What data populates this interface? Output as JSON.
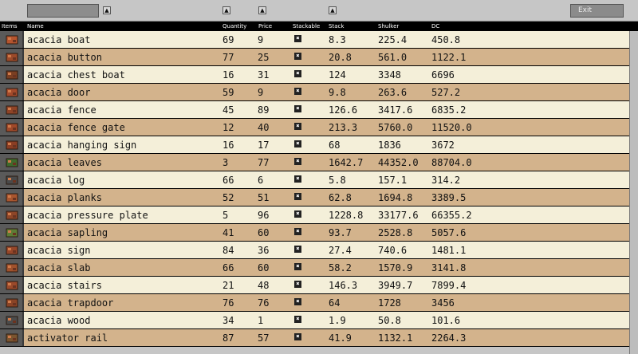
{
  "toolbar": {
    "search_value": "",
    "sort_glyph": "▲",
    "exit_label": "Exit"
  },
  "columns": {
    "items": "Items",
    "name": "Name",
    "quantity": "Quantity",
    "price": "Price",
    "stackable": "Stackable",
    "stack": "Stack",
    "shulker": "Shulker",
    "dc": "DC"
  },
  "rows": [
    {
      "name": "acacia boat",
      "quantity": "69",
      "price": "9",
      "stackable_glyph": "✖",
      "stack": "8.3",
      "shulker": "225.4",
      "dc": "450.8",
      "icon": "boat-icon"
    },
    {
      "name": "acacia button",
      "quantity": "77",
      "price": "25",
      "stackable_glyph": "✖",
      "stack": "20.8",
      "shulker": "561.0",
      "dc": "1122.1",
      "icon": "button-icon"
    },
    {
      "name": "acacia chest boat",
      "quantity": "16",
      "price": "31",
      "stackable_glyph": "✖",
      "stack": "124",
      "shulker": "3348",
      "dc": "6696",
      "icon": "chest-boat-icon"
    },
    {
      "name": "acacia door",
      "quantity": "59",
      "price": "9",
      "stackable_glyph": "✖",
      "stack": "9.8",
      "shulker": "263.6",
      "dc": "527.2",
      "icon": "door-icon"
    },
    {
      "name": "acacia fence",
      "quantity": "45",
      "price": "89",
      "stackable_glyph": "✖",
      "stack": "126.6",
      "shulker": "3417.6",
      "dc": "6835.2",
      "icon": "fence-icon"
    },
    {
      "name": "acacia fence gate",
      "quantity": "12",
      "price": "40",
      "stackable_glyph": "✖",
      "stack": "213.3",
      "shulker": "5760.0",
      "dc": "11520.0",
      "icon": "fence-gate-icon"
    },
    {
      "name": "acacia hanging sign",
      "quantity": "16",
      "price": "17",
      "stackable_glyph": "✖",
      "stack": "68",
      "shulker": "1836",
      "dc": "3672",
      "icon": "hanging-sign-icon"
    },
    {
      "name": "acacia leaves",
      "quantity": "3",
      "price": "77",
      "stackable_glyph": "✖",
      "stack": "1642.7",
      "shulker": "44352.0",
      "dc": "88704.0",
      "icon": "leaves-icon"
    },
    {
      "name": "acacia log",
      "quantity": "66",
      "price": "6",
      "stackable_glyph": "✖",
      "stack": "5.8",
      "shulker": "157.1",
      "dc": "314.2",
      "icon": "log-icon"
    },
    {
      "name": "acacia planks",
      "quantity": "52",
      "price": "51",
      "stackable_glyph": "✖",
      "stack": "62.8",
      "shulker": "1694.8",
      "dc": "3389.5",
      "icon": "planks-icon"
    },
    {
      "name": "acacia pressure plate",
      "quantity": "5",
      "price": "96",
      "stackable_glyph": "✖",
      "stack": "1228.8",
      "shulker": "33177.6",
      "dc": "66355.2",
      "icon": "pressure-plate-icon"
    },
    {
      "name": "acacia sapling",
      "quantity": "41",
      "price": "60",
      "stackable_glyph": "✖",
      "stack": "93.7",
      "shulker": "2528.8",
      "dc": "5057.6",
      "icon": "sapling-icon"
    },
    {
      "name": "acacia sign",
      "quantity": "84",
      "price": "36",
      "stackable_glyph": "✖",
      "stack": "27.4",
      "shulker": "740.6",
      "dc": "1481.1",
      "icon": "sign-icon"
    },
    {
      "name": "acacia slab",
      "quantity": "66",
      "price": "60",
      "stackable_glyph": "✖",
      "stack": "58.2",
      "shulker": "1570.9",
      "dc": "3141.8",
      "icon": "slab-icon"
    },
    {
      "name": "acacia stairs",
      "quantity": "21",
      "price": "48",
      "stackable_glyph": "✖",
      "stack": "146.3",
      "shulker": "3949.7",
      "dc": "7899.4",
      "icon": "stairs-icon"
    },
    {
      "name": "acacia trapdoor",
      "quantity": "76",
      "price": "76",
      "stackable_glyph": "✖",
      "stack": "64",
      "shulker": "1728",
      "dc": "3456",
      "icon": "trapdoor-icon"
    },
    {
      "name": "acacia wood",
      "quantity": "34",
      "price": "1",
      "stackable_glyph": "✖",
      "stack": "1.9",
      "shulker": "50.8",
      "dc": "101.6",
      "icon": "wood-icon"
    },
    {
      "name": "activator rail",
      "quantity": "87",
      "price": "57",
      "stackable_glyph": "✖",
      "stack": "41.9",
      "shulker": "1132.1",
      "dc": "2264.3",
      "icon": "rail-icon"
    }
  ],
  "colors": {
    "row_light": "#f4efd9",
    "row_dark": "#d3b38c",
    "header_bg": "#000000",
    "topbar_bg": "#c6c6c6"
  }
}
